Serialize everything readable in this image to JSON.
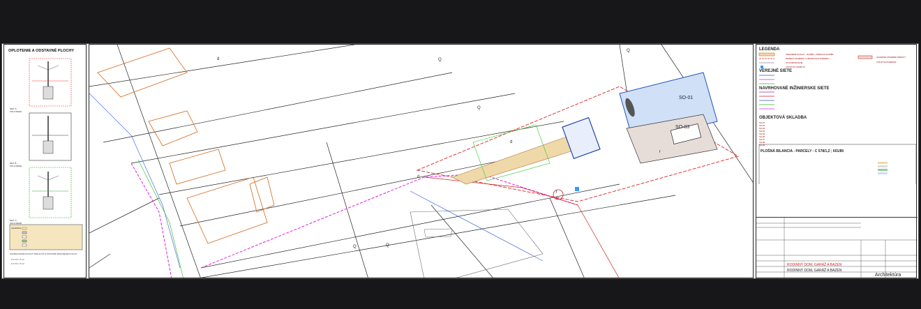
{
  "left_panel": {
    "title": "OPLOTENIE A ODSTAVNÉ PLOCHY",
    "detail_texts": [
      "REZ 'A' - OPLOTENIE",
      "REZ 'B' - OPLOTENIE",
      "REZ 'C' - OPLOTENIE"
    ],
    "legend_lines": [
      "LEGENDA:"
    ],
    "note_lines": [
      "NAVRHOVANÉ PLOCHY PRE AUTÁ A OSTATNÉ SPEVNENÉ PLOCHY",
      "- 2 X 2,5 = 5 m²",
      "- 2 X 2,5 = 5 m²"
    ]
  },
  "plan": {
    "parcel_labels": [
      "d",
      "Q",
      "Q",
      "Q",
      "d",
      "r",
      "d",
      "Q",
      "Q"
    ],
    "building_labels": [
      "SO-01",
      "SO-03"
    ],
    "scale_ref": "1"
  },
  "legend": {
    "title": "LEGENDA",
    "rows": [
      "SPEVNENÉ PLOCHY - DLAŽBA - ZÁMKOVÁ DLAŽBA",
      "RIEŠENÝ POZEMOK V HRANICIACH POZEMKU",
      "OS KOMUNIKÁCIE",
      "VSTUP DO OBJEKTU"
    ],
    "right_rows": [
      "OSADENÉ STAVEBNÉ OBJEKTY",
      "VSTUP NA POZEMOK"
    ],
    "verejne_title": "VEREJNÉ SIETE",
    "navrh_title": "NAVRHOVANÉ INŽINIERSKE SIETE",
    "objekt_title": "OBJEKTOVÁ SKLADBA",
    "objekt_rows": [
      "SO-01",
      "SO-02",
      "SO-03",
      "SO-04",
      "SO-05",
      "SO-06",
      "SO-07",
      "SO-08",
      "SO-09"
    ],
    "plosna_title": "PLOŠNÁ BILANCIA - PARCELY - C 578/1,2 ; 601/80"
  },
  "title_block": {
    "project_rows": [
      "RODINNÝ DOM, GARÁŽ A BAZÉN",
      "RODINNÝ DOM, GARÁŽ A BAZÉN"
    ],
    "discipline": "Architektúra"
  }
}
